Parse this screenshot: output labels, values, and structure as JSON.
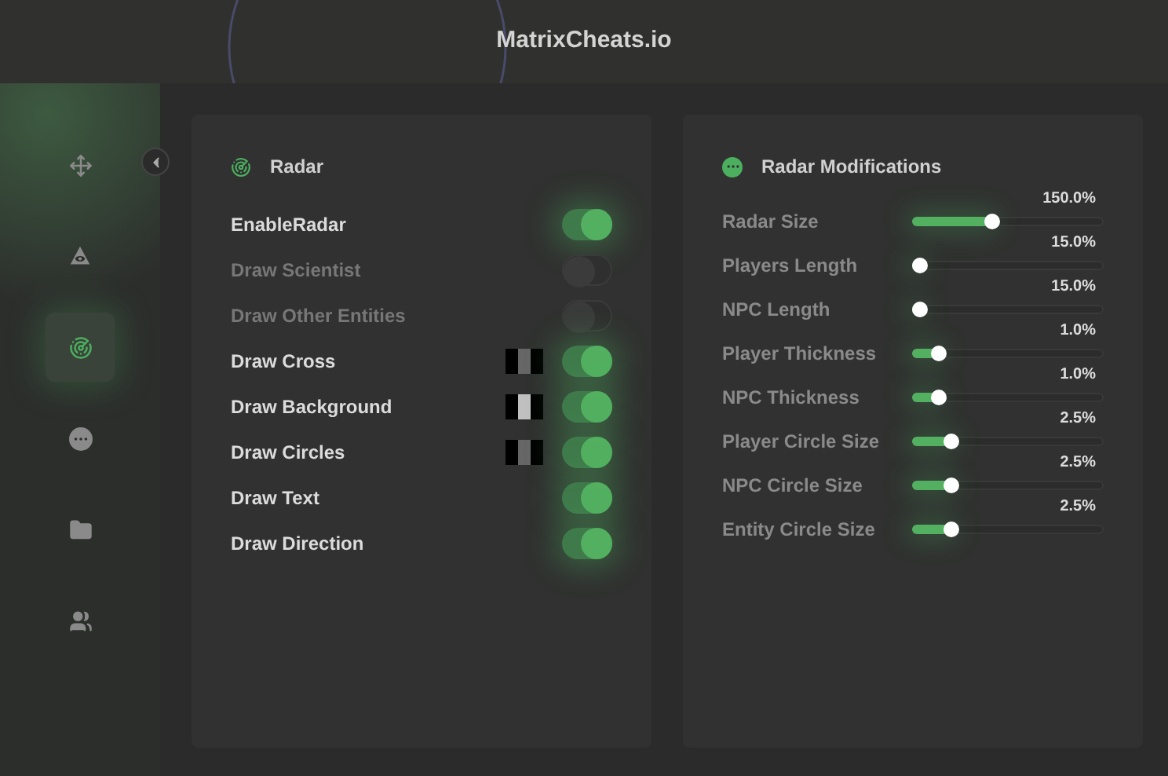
{
  "window": {
    "title": "MatrixCheats.io"
  },
  "sidebar": {
    "items": [
      {
        "selected": false
      },
      {
        "selected": false
      },
      {
        "selected": true
      },
      {
        "selected": false
      },
      {
        "selected": false
      },
      {
        "selected": false
      }
    ]
  },
  "radar_panel": {
    "title": "Radar",
    "options": [
      {
        "label": "EnableRadar",
        "on": true
      },
      {
        "label": "Draw Scientist",
        "on": false
      },
      {
        "label": "Draw Other Entities",
        "on": false
      },
      {
        "label": "Draw Cross",
        "on": true,
        "kind": "color",
        "color": "#666666"
      },
      {
        "label": "Draw Background",
        "on": true,
        "kind": "color",
        "color": "#c0c0c0"
      },
      {
        "label": "Draw Circles",
        "on": true,
        "kind": "color",
        "color": "#666666"
      },
      {
        "label": "Draw Text",
        "on": true
      },
      {
        "label": "Draw Direction",
        "on": true
      }
    ]
  },
  "modifications_panel": {
    "title": "Radar Modifications",
    "sliders": [
      {
        "label": "Radar Size",
        "reading": "150.0%",
        "level": 0.41
      },
      {
        "label": "Players Length",
        "reading": "15.0%",
        "level": 0
      },
      {
        "label": "NPC Length",
        "reading": "15.0%",
        "level": 0
      },
      {
        "label": "Player Thickness",
        "reading": "1.0%",
        "level": 0.11
      },
      {
        "label": "NPC Thickness",
        "reading": "1.0%",
        "level": 0.11
      },
      {
        "label": "Player Circle Size",
        "reading": "2.5%",
        "level": 0.18
      },
      {
        "label": "NPC Circle Size",
        "reading": "2.5%",
        "level": 0.18
      },
      {
        "label": "Entity Circle Size",
        "reading": "2.5%",
        "level": 0.18
      }
    ]
  }
}
